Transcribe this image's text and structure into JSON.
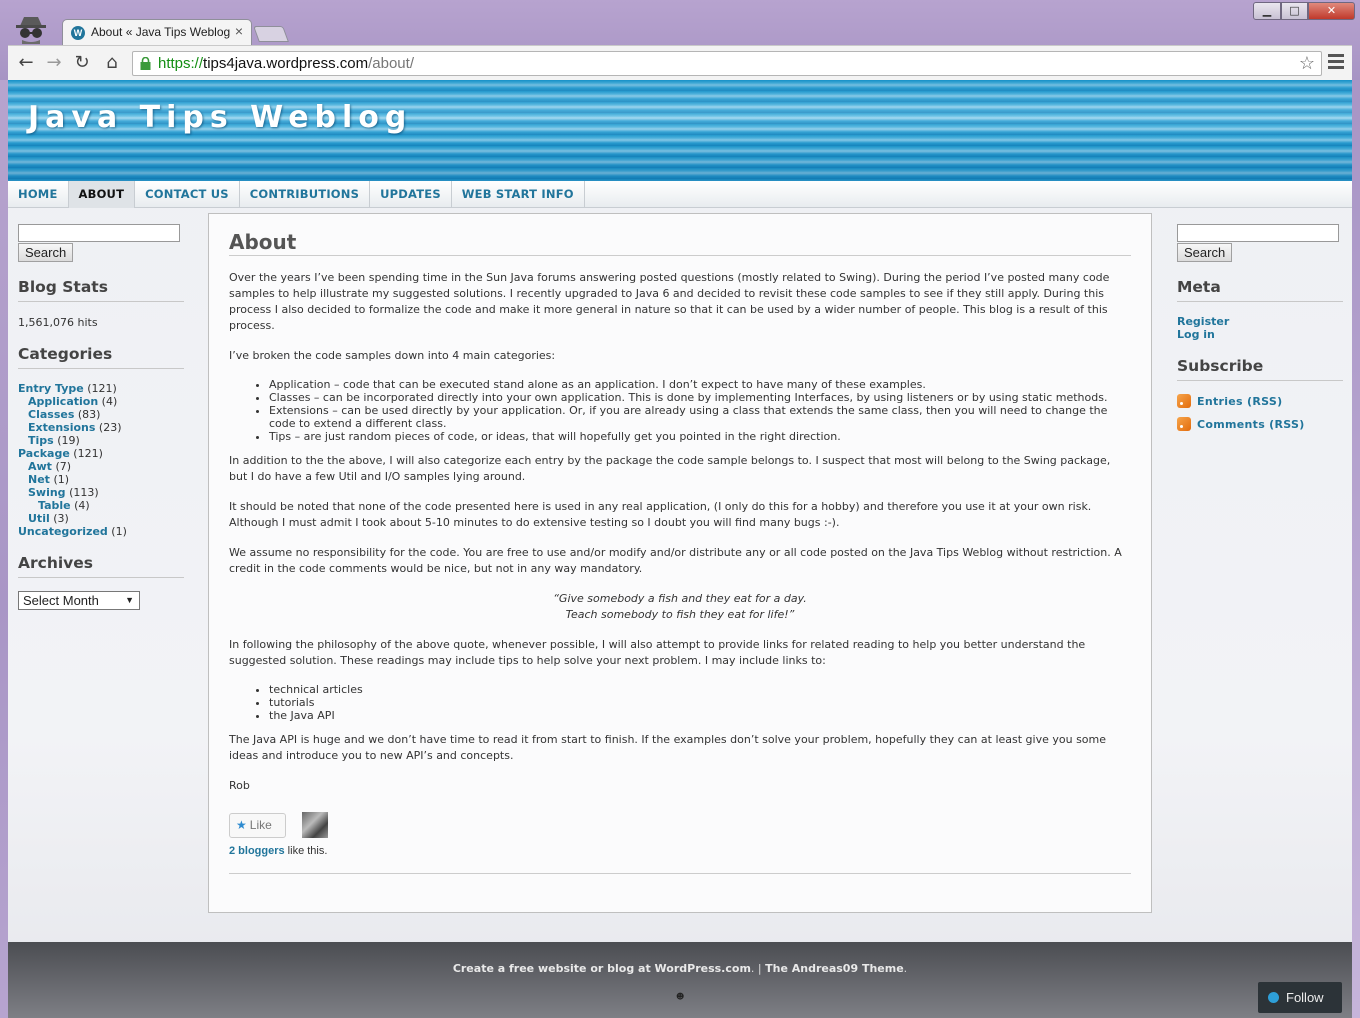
{
  "browser": {
    "tab_title": "About « Java Tips Weblog",
    "tab_close": "×",
    "url_scheme": "https://",
    "url_host": "tips4java.wordpress.com",
    "url_path": "/about/",
    "back": "←",
    "forward": "→",
    "reload": "↻",
    "home": "⌂",
    "bookmark_star": "☆",
    "win_min": "▁",
    "win_max": "□",
    "win_close": "✕"
  },
  "site": {
    "title": "Java Tips Weblog"
  },
  "nav": {
    "items": [
      {
        "label": "HOME"
      },
      {
        "label": "ABOUT"
      },
      {
        "label": "CONTACT US"
      },
      {
        "label": "CONTRIBUTIONS"
      },
      {
        "label": "UPDATES"
      },
      {
        "label": "WEB START INFO"
      }
    ]
  },
  "left_sidebar": {
    "search_button": "Search",
    "blog_stats_title": "Blog Stats",
    "hits": "1,561,076 hits",
    "categories_title": "Categories",
    "categories": [
      {
        "name": "Entry Type",
        "count": "(121)"
      },
      {
        "name": "Application",
        "count": "(4)"
      },
      {
        "name": "Classes",
        "count": "(83)"
      },
      {
        "name": "Extensions",
        "count": "(23)"
      },
      {
        "name": "Tips",
        "count": "(19)"
      },
      {
        "name": "Package",
        "count": "(121)"
      },
      {
        "name": "Awt",
        "count": "(7)"
      },
      {
        "name": "Net",
        "count": "(1)"
      },
      {
        "name": "Swing",
        "count": "(113)"
      },
      {
        "name": "Table",
        "count": "(4)"
      },
      {
        "name": "Util",
        "count": "(3)"
      },
      {
        "name": "Uncategorized",
        "count": "(1)"
      }
    ],
    "archives_title": "Archives",
    "archives_select": "Select Month",
    "select_arrow": "▼"
  },
  "right_sidebar": {
    "search_button": "Search",
    "meta_title": "Meta",
    "meta_links": [
      "Register",
      "Log in"
    ],
    "subscribe_title": "Subscribe",
    "rss_entries": "Entries (RSS)",
    "rss_comments": "Comments (RSS)"
  },
  "content": {
    "title": "About",
    "p1": "Over the years I’ve been spending time in the Sun Java forums answering posted questions (mostly related to Swing). During the period I’ve posted many code samples to help illustrate my suggested solutions. I recently upgraded to Java 6 and decided to revisit these code samples to see if they still apply. During this process I also decided to formalize the code and make it more general in nature so that it can be used by a wider number of people. This blog is a result of this process.",
    "p2": "I’ve broken the code samples down into 4 main categories:",
    "list1": [
      "Application – code that can be executed stand alone as an application. I don’t expect to have many of these examples.",
      "Classes – can be incorporated directly into your own application. This is done by implementing Interfaces, by using listeners or by using static methods.",
      "Extensions – can be used directly by your application. Or, if you are already using a class that extends the same class, then you will need to change the code to extend a different class.",
      "Tips – are just random pieces of code, or ideas, that will hopefully get you pointed in the right direction."
    ],
    "p3": "In addition to the the above, I will also categorize each entry by the package the code sample belongs to. I suspect that most will belong to the Swing package, but I do have a few Util and I/O samples lying around.",
    "p4": "It should be noted that none of the code presented here is used in any real application,  (I only do this for a hobby) and therefore you use it at your own risk. Although I must admit I took about 5-10 minutes to do extensive testing so I doubt you will find many bugs :-).",
    "p5": "We assume no responsibility for the code. You are free to use and/or modify and/or distribute any or all code posted on the Java Tips Weblog without restriction. A credit in the code comments would be nice, but not in any way mandatory.",
    "quote_line1": "“Give somebody a fish and they eat for a day.",
    "quote_line2": "Teach somebody to fish they eat for life!”",
    "p6": "In following the philosophy of the above quote, whenever possible, I will also attempt to provide links for related reading to help you better understand the suggested solution. These readings may include tips to help solve your next problem. I may include links to:",
    "list2": [
      "technical articles",
      "tutorials",
      "the Java API"
    ],
    "p7": "The Java API is huge and we don’t have time to read it from start to finish. If the examples don’t solve your problem, hopefully they can at least give you some ideas and introduce you to new API’s and concepts.",
    "signature": "Rob",
    "like_label": "Like",
    "like_star": "★",
    "bloggers_link": "2 bloggers",
    "bloggers_suffix": " like this."
  },
  "footer": {
    "credit_link": "Create a free website or blog at WordPress.com",
    "separator": ". | ",
    "theme_link": "The Andreas09 Theme",
    "end": ".",
    "follow_label": "Follow",
    "dot": "☻"
  }
}
